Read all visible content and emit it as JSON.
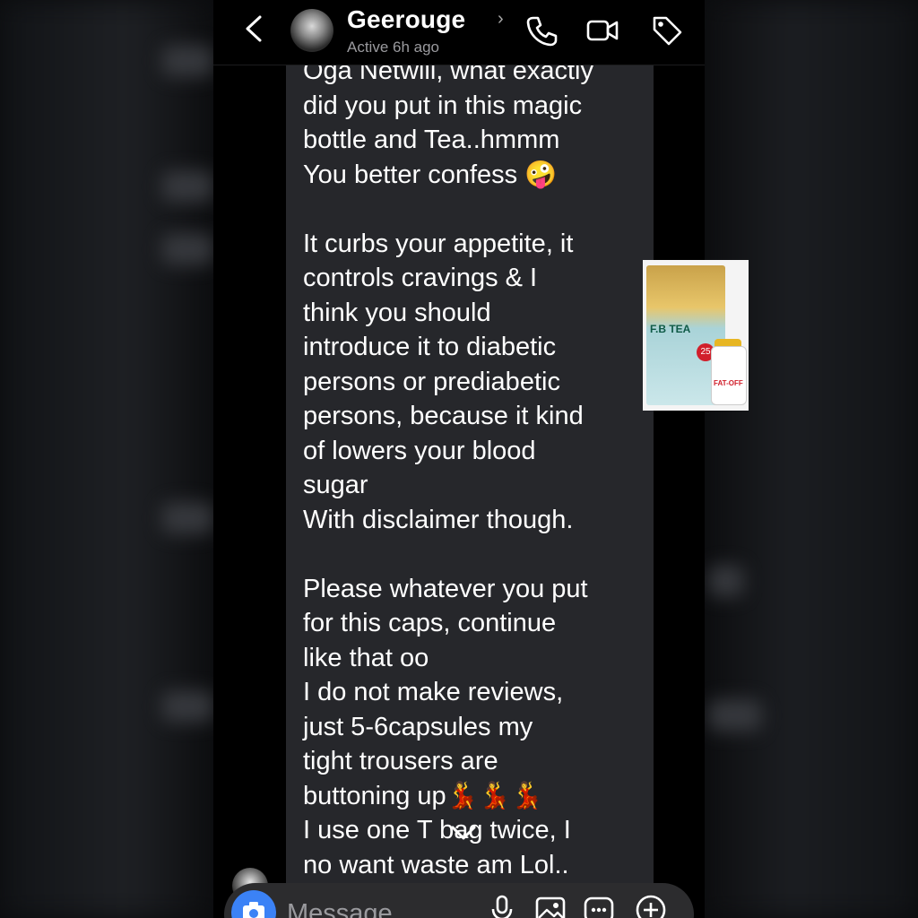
{
  "header": {
    "contact_name": "Geerouge",
    "status": "Active 6h ago"
  },
  "message": {
    "lines": [
      "Oga Netwill, what exactly",
      "did you put in this magic",
      "bottle and Tea..hmmm",
      "You better confess 🤪",
      "",
      "It curbs your appetite,  it",
      "controls cravings & I",
      "think you should",
      "introduce it to diabetic",
      "persons or prediabetic",
      "persons, because it kind",
      "of lowers your blood",
      "sugar",
      "With disclaimer though.",
      "",
      "Please whatever you put",
      "for this caps, continue",
      "like that oo",
      "I do not make reviews,",
      "just 5-6capsules my",
      "tight trousers are",
      "buttoning up💃💃💃",
      "I use one T  bag twice, I",
      "no want waste am Lol.."
    ]
  },
  "product": {
    "pouch_text": "F.B TEA",
    "badge": "25",
    "bottle_text": "FAT-OFF"
  },
  "composer": {
    "placeholder": "Message..."
  },
  "icons": {
    "back": "chevron-left-icon",
    "call": "phone-icon",
    "video": "video-icon",
    "tag": "tag-icon",
    "camera": "camera-icon",
    "mic": "microphone-icon",
    "gallery": "image-icon",
    "sticker": "sticker-icon",
    "plus": "plus-circle-icon",
    "scroll": "chevron-down-icon"
  },
  "colors": {
    "bubble": "#26272b",
    "accent": "#3b82f6"
  }
}
